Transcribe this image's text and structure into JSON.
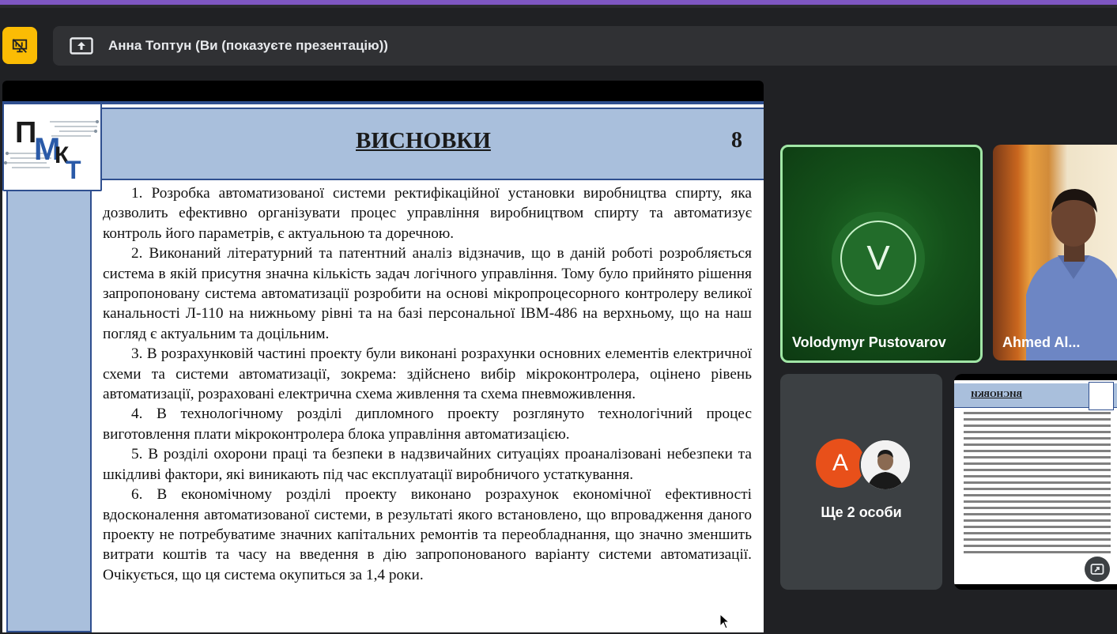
{
  "presenter_bar": {
    "text": "Анна Топтун (Ви (показуєте презентацію))"
  },
  "slide": {
    "title": "ВИСНОВКИ",
    "page_number": "8",
    "logo_text": "ПМКТ",
    "paragraphs": [
      "1. Розробка автоматизованої системи ректифікаційної установки виробництва спирту, яка дозволить ефективно організувати процес управління виробництвом спирту та автоматизує контроль його параметрів, є актуальною та доречною.",
      "2. Виконаний літературний та патентний аналіз відзначив, що в даній роботі розробляється система в якій присутня значна кількість задач логічного управління. Тому було прийнято рішення запропоновану система автоматизації розробити на основі мікропроцесорного контролеру великої канальності Л-110 на нижньому рівні та на базі персональної IBM-486 на верхньому, що на наш погляд є актуальним та доцільним.",
      "3. В розрахунковій частині проекту були виконані розрахунки основних елементів електричної схеми та системи автоматизації, зокрема: здійснено вибір мікроконтролера, оцінено рівень автоматизації, розраховані електрична схема живлення та схема пневможивлення.",
      "4. В технологічному розділі дипломного проекту розглянуто технологічний процес виготовлення плати мікроконтролера блока управління автоматизацією.",
      "5. В розділі охорони праці та безпеки в надзвичайних ситуаціях проаналізовані небезпеки та шкідливі фактори, які виникають під час експлуатації виробничого устаткування.",
      "6. В економічному розділі проекту виконано розрахунок економічної ефективності вдосконалення автоматизованої системи, в результаті якого встановлено, що впровадження даного проекту не потребуватиме значних капітальних ремонтів та переобладнання, що значно зменшить витрати коштів та часу на введення в дію запропонованого варіанту системи автоматизації. Очікується, що ця система окупиться за 1,4 роки."
    ]
  },
  "participants": {
    "tile1": {
      "initial": "V",
      "name": "Volodymyr Pustovarov"
    },
    "tile2": {
      "name": "Ahmed Al..."
    },
    "more": {
      "initial": "A",
      "label": "Ще 2 особи"
    },
    "self": {
      "name": "Анна Топтун",
      "mini_title": "ВИСНОВКИ"
    }
  },
  "colors": {
    "accent_yellow": "#fbbc04",
    "active_speaker_border": "#a1e6a6",
    "slide_header_blue": "#a9bfdc",
    "avatar_orange": "#e8501a"
  },
  "icons": {
    "present_off": "presentation-off-icon",
    "present_screen": "present-screen-icon",
    "expand": "expand-icon"
  }
}
